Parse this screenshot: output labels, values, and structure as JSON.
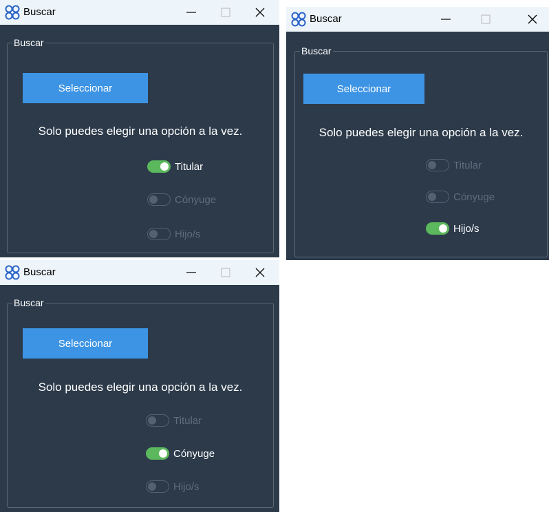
{
  "windows": [
    {
      "title": "Buscar",
      "group_label": "Buscar",
      "select_button": "Seleccionar",
      "message": "Solo puedes elegir una opción a la vez.",
      "options": [
        {
          "label": "Titular",
          "checked": true
        },
        {
          "label": "Cónyuge",
          "checked": false
        },
        {
          "label": "Hijo/s",
          "checked": false
        }
      ]
    },
    {
      "title": "Buscar",
      "group_label": "Buscar",
      "select_button": "Seleccionar",
      "message": "Solo puedes elegir una opción a la vez.",
      "options": [
        {
          "label": "Titular",
          "checked": false
        },
        {
          "label": "Cónyuge",
          "checked": false
        },
        {
          "label": "Hijo/s",
          "checked": true
        }
      ]
    },
    {
      "title": "Buscar",
      "group_label": "Buscar",
      "select_button": "Seleccionar",
      "message": "Solo puedes elegir una opción a la vez.",
      "options": [
        {
          "label": "Titular",
          "checked": false
        },
        {
          "label": "Cónyuge",
          "checked": true
        },
        {
          "label": "Hijo/s",
          "checked": false
        }
      ]
    }
  ],
  "colors": {
    "window_bg": "#2c3a4a",
    "titlebar_bg": "#eef5fa",
    "button_bg": "#3d94e4",
    "toggle_on": "#5cb85c",
    "toggle_off": "#536170",
    "label_disabled": "#5e6c7b"
  },
  "icons": {
    "app": "app-logo-icon",
    "minimize": "minimize-icon",
    "maximize": "maximize-icon",
    "close": "close-icon"
  }
}
